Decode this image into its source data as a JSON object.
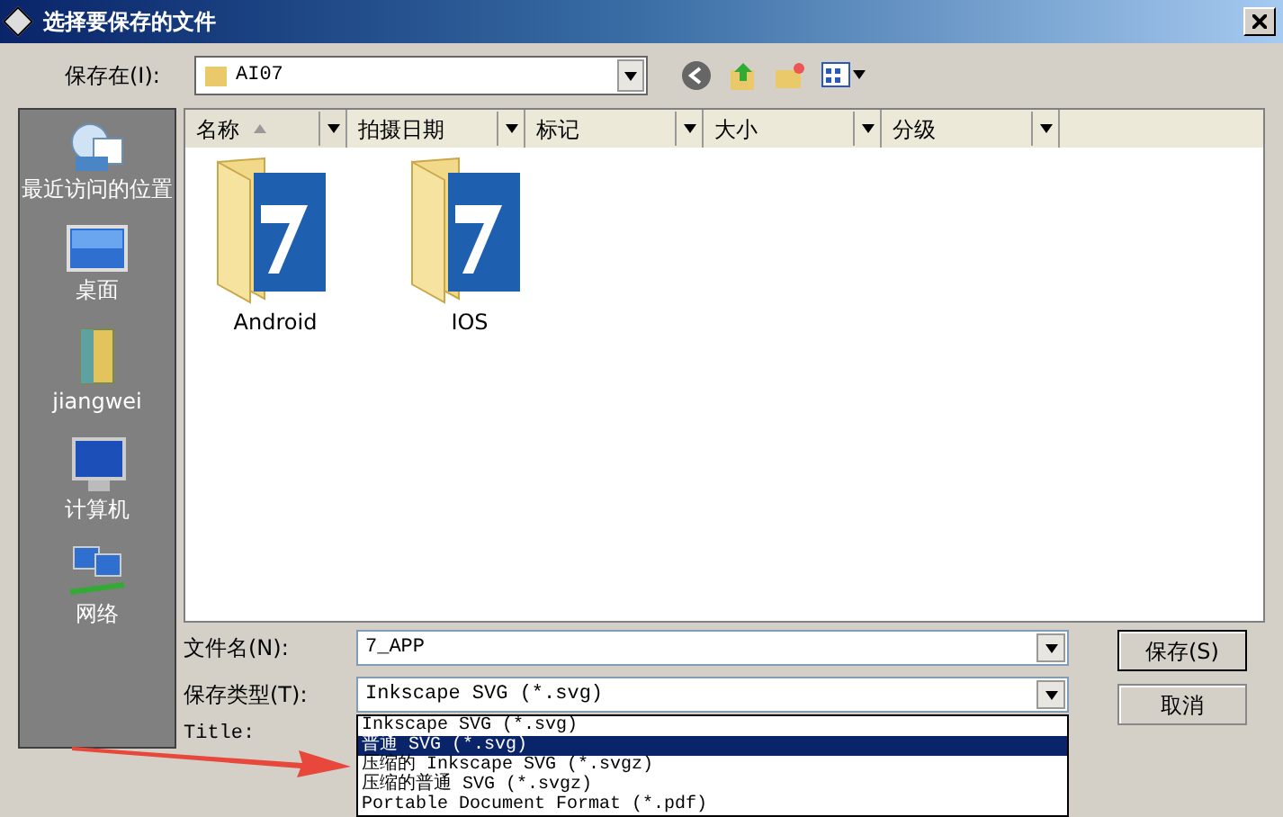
{
  "window": {
    "title": "选择要保存的文件"
  },
  "save_in": {
    "label": "保存在(I):",
    "value": "AI07"
  },
  "places": [
    {
      "label": "最近访问的位置",
      "kind": "recent"
    },
    {
      "label": "桌面",
      "kind": "desktop"
    },
    {
      "label": "jiangwei",
      "kind": "user"
    },
    {
      "label": "计算机",
      "kind": "computer"
    },
    {
      "label": "网络",
      "kind": "network"
    }
  ],
  "columns": [
    {
      "label": "名称",
      "sorted": true
    },
    {
      "label": "拍摄日期",
      "sorted": false
    },
    {
      "label": "标记",
      "sorted": false
    },
    {
      "label": "大小",
      "sorted": false
    },
    {
      "label": "分级",
      "sorted": false
    }
  ],
  "files": [
    {
      "name": "Android"
    },
    {
      "name": "IOS"
    }
  ],
  "file_name": {
    "label": "文件名(N):",
    "value": "7_APP"
  },
  "file_type": {
    "label": "保存类型(T):",
    "value": "Inkscape SVG (*.svg)"
  },
  "title_label": "Title:",
  "type_options": [
    {
      "label": "Inkscape SVG (*.svg)",
      "selected": false
    },
    {
      "label": "普通 SVG (*.svg)",
      "selected": true
    },
    {
      "label": "压缩的 Inkscape SVG (*.svgz)",
      "selected": false
    },
    {
      "label": "压缩的普通 SVG (*.svgz)",
      "selected": false
    },
    {
      "label": "Portable Document Format (*.pdf)",
      "selected": false
    }
  ],
  "buttons": [
    "保存(S)",
    "取消"
  ]
}
